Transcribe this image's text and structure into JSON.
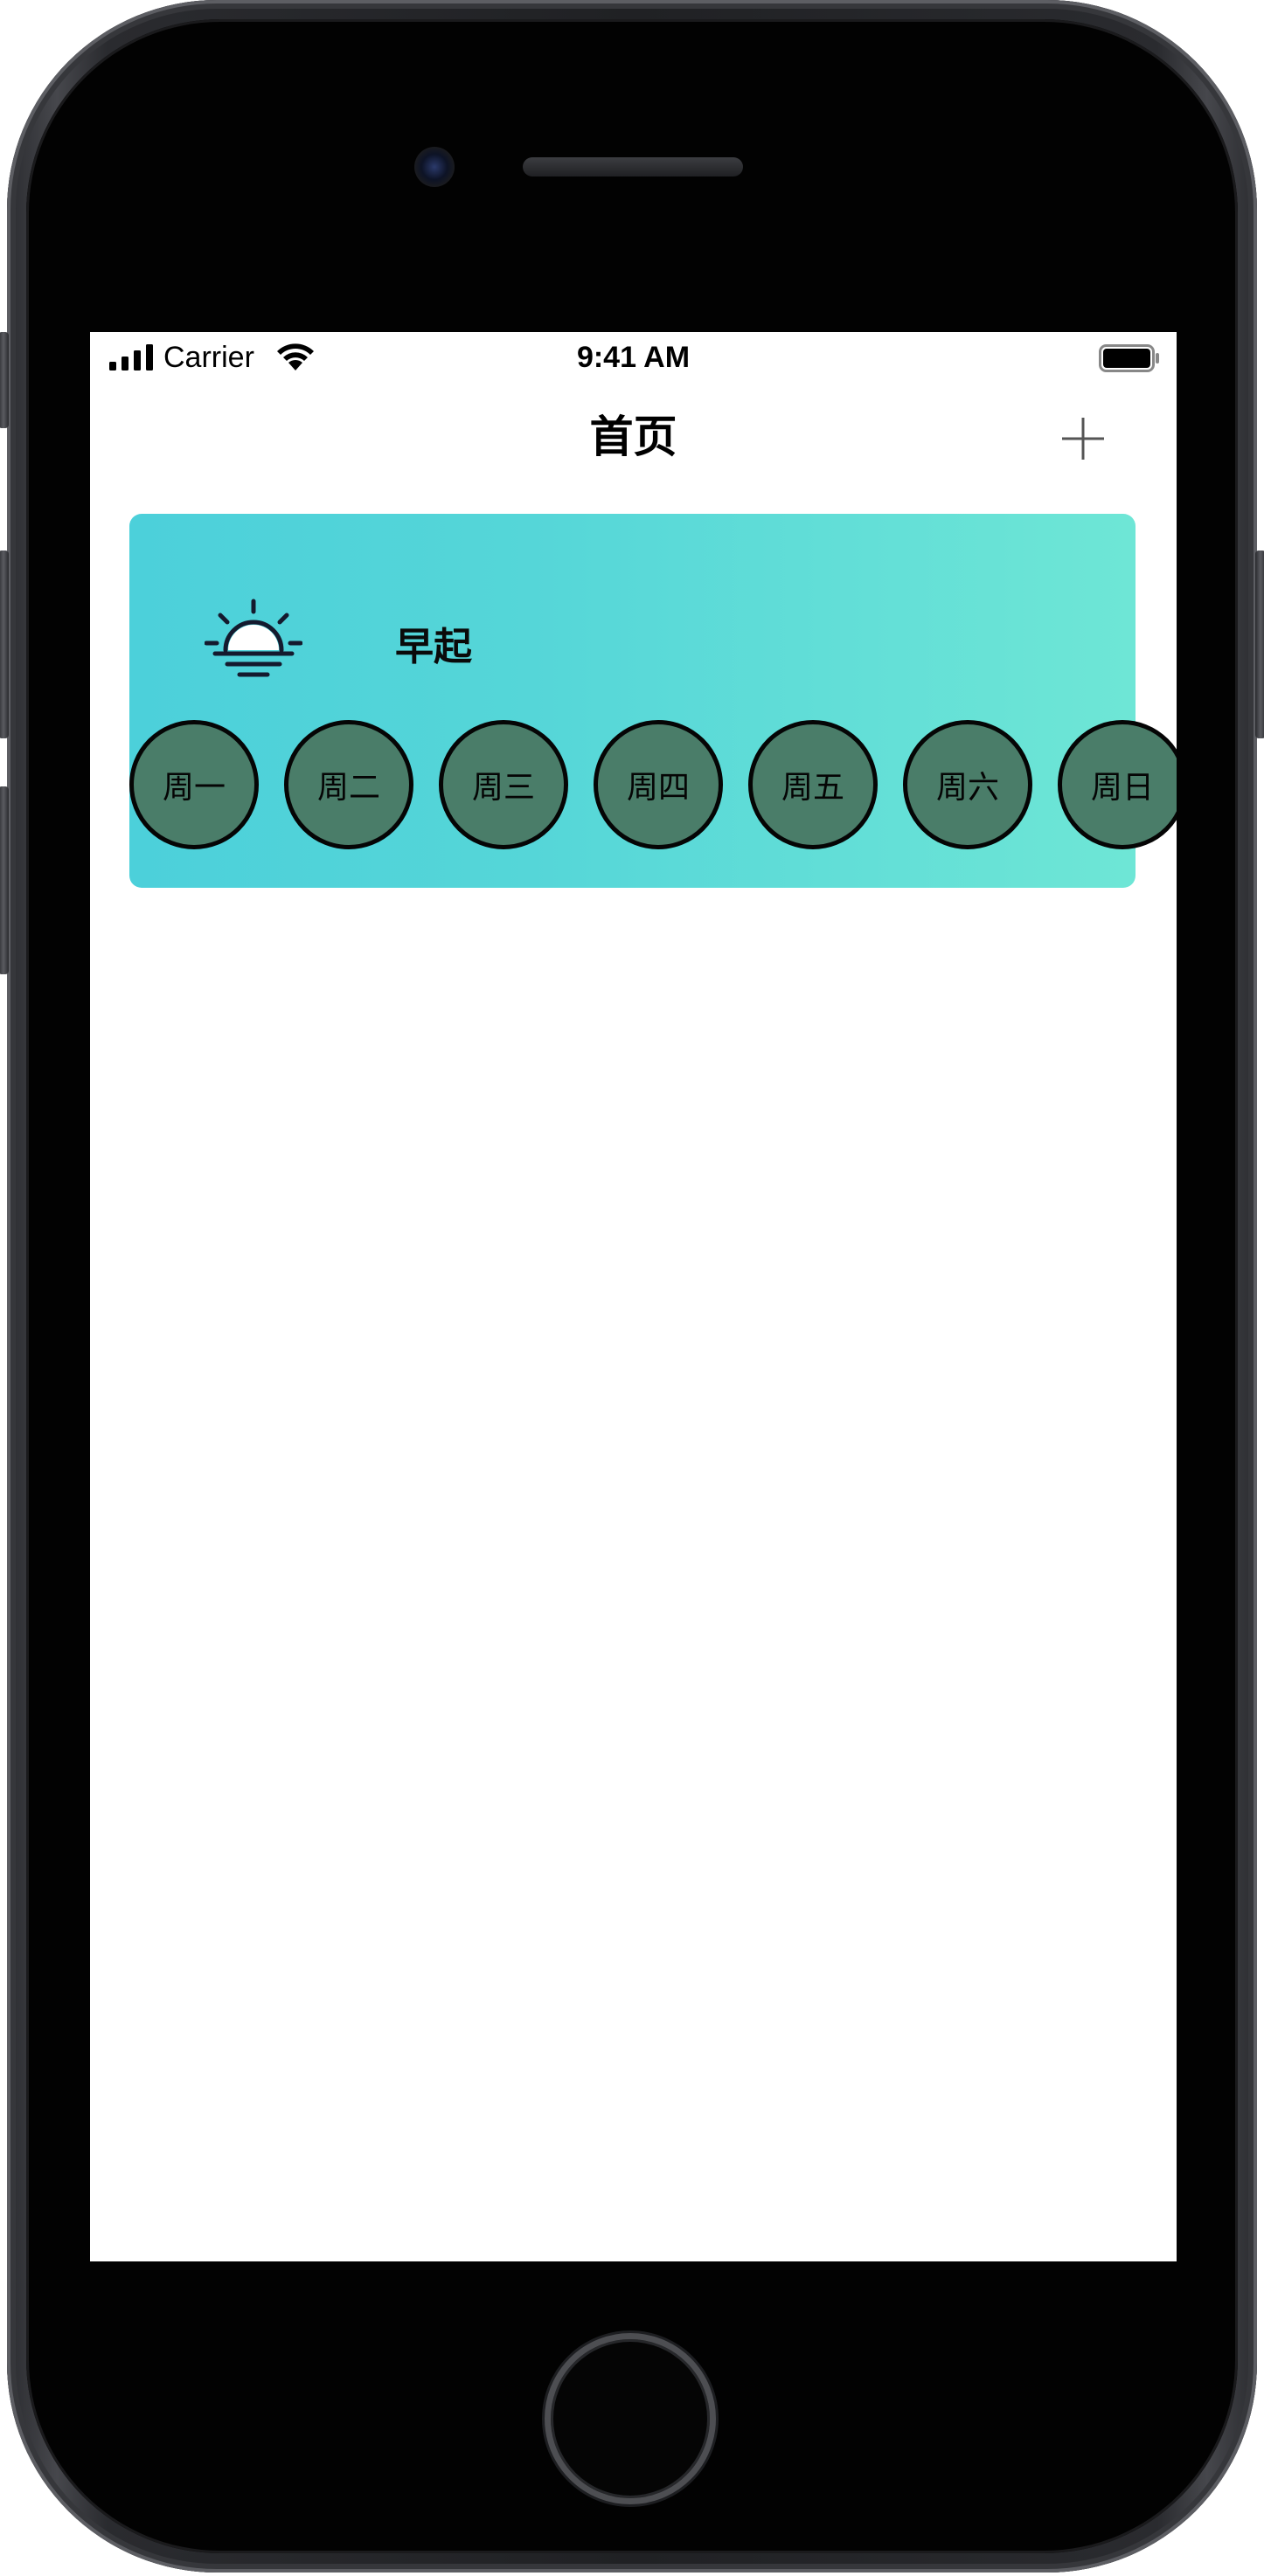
{
  "status_bar": {
    "carrier": "Carrier",
    "time": "9:41 AM"
  },
  "nav": {
    "title": "首页",
    "add_icon": "plus-icon"
  },
  "habit": {
    "icon": "sunrise-icon",
    "name": "早起",
    "card_gradient": [
      "#4cd0da",
      "#6ee6d6"
    ],
    "days": [
      {
        "label": "周一"
      },
      {
        "label": "周二"
      },
      {
        "label": "周三"
      },
      {
        "label": "周四"
      },
      {
        "label": "周五"
      },
      {
        "label": "周六"
      },
      {
        "label": "周日"
      }
    ],
    "day_color": "#4a7d69"
  }
}
